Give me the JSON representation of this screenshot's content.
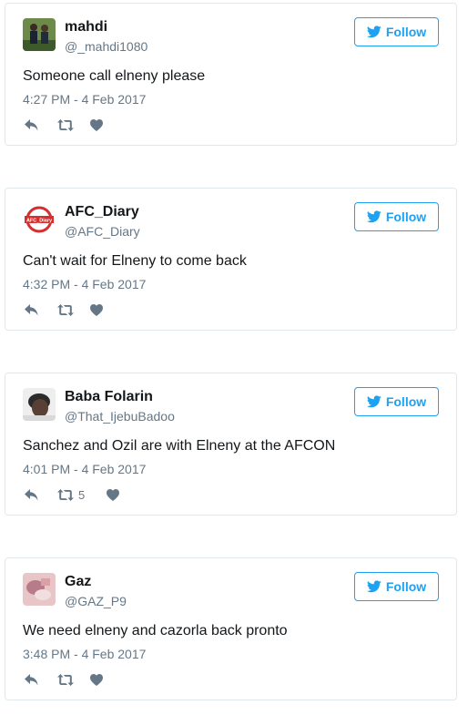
{
  "follow_label": "Follow",
  "brand_color": "#1da1f2",
  "tweets": [
    {
      "display_name": "mahdi",
      "handle": "@_mahdi1080",
      "text": "Someone call elneny please",
      "timestamp": "4:27 PM - 4 Feb 2017",
      "retweet_count": "",
      "avatar_icon": "photo-two-players"
    },
    {
      "display_name": "AFC_Diary",
      "handle": "@AFC_Diary",
      "text": "Can't wait for Elneny to come back",
      "timestamp": "4:32 PM - 4 Feb 2017",
      "retweet_count": "",
      "avatar_icon": "afc-diary-logo",
      "avatar_logo_text": "AFC_Diary"
    },
    {
      "display_name": "Baba Folarin",
      "handle": "@That_IjebuBadoo",
      "text": "Sanchez and Ozil are with Elneny at the AFCON",
      "timestamp": "4:01 PM - 4 Feb 2017",
      "retweet_count": "5",
      "avatar_icon": "photo-portrait"
    },
    {
      "display_name": "Gaz",
      "handle": "@GAZ_P9",
      "text": "We need elneny and cazorla back pronto",
      "timestamp": "3:48 PM - 4 Feb 2017",
      "retweet_count": "",
      "avatar_icon": "photo-pink"
    }
  ]
}
